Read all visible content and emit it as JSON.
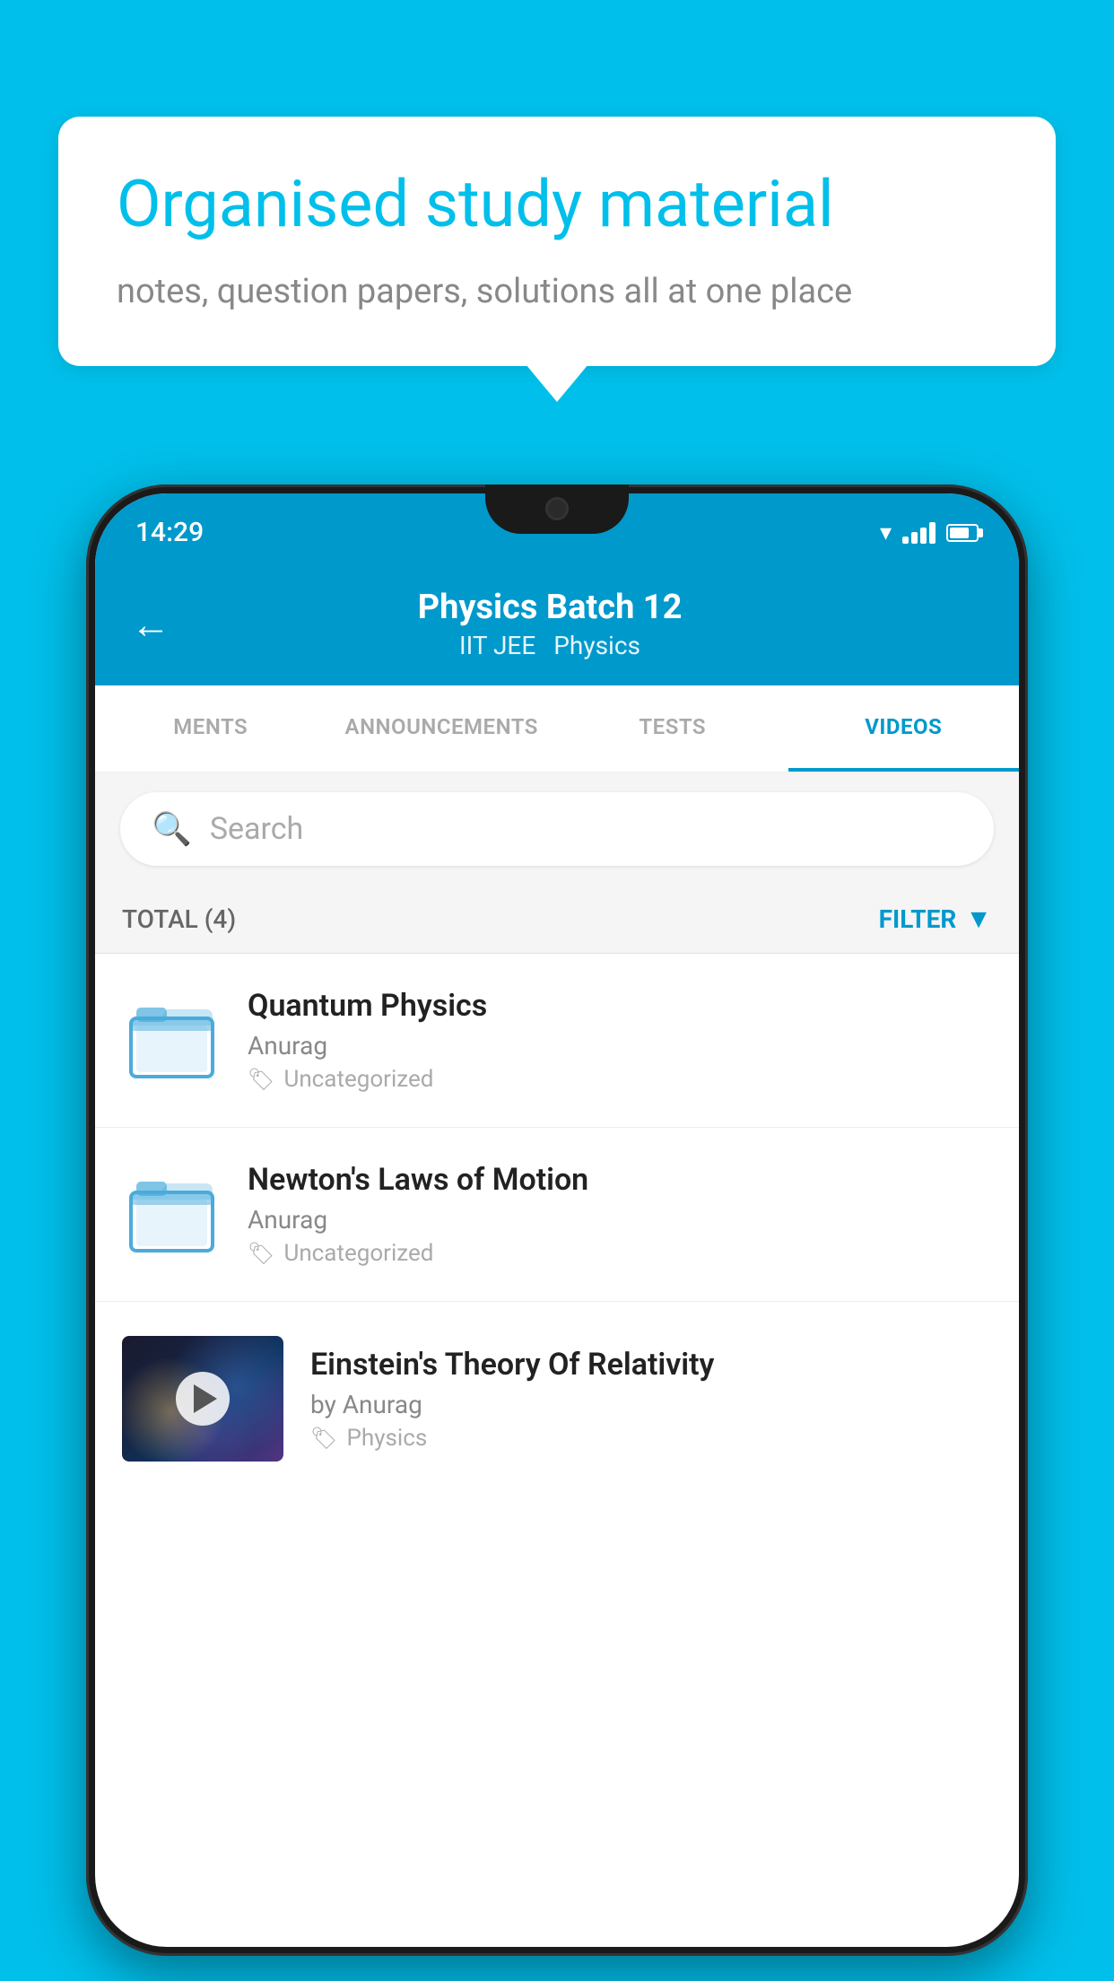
{
  "background_color": "#00BFEA",
  "speech_bubble": {
    "heading": "Organised study material",
    "subtext": "notes, question papers, solutions all at one place"
  },
  "status_bar": {
    "time": "14:29",
    "wifi": "▼",
    "battery_pct": 75
  },
  "app_header": {
    "back_label": "←",
    "batch_name": "Physics Batch 12",
    "tag1": "IIT JEE",
    "tag2": "Physics"
  },
  "tabs": [
    {
      "label": "MENTS",
      "active": false
    },
    {
      "label": "ANNOUNCEMENTS",
      "active": false
    },
    {
      "label": "TESTS",
      "active": false
    },
    {
      "label": "VIDEOS",
      "active": true
    }
  ],
  "search": {
    "placeholder": "Search"
  },
  "filter_row": {
    "total_label": "TOTAL (4)",
    "filter_label": "FILTER"
  },
  "videos": [
    {
      "title": "Quantum Physics",
      "author": "Anurag",
      "tag": "Uncategorized",
      "has_thumb": false
    },
    {
      "title": "Newton's Laws of Motion",
      "author": "Anurag",
      "tag": "Uncategorized",
      "has_thumb": false
    },
    {
      "title": "Einstein's Theory Of Relativity",
      "author": "by Anurag",
      "tag": "Physics",
      "has_thumb": true
    }
  ]
}
